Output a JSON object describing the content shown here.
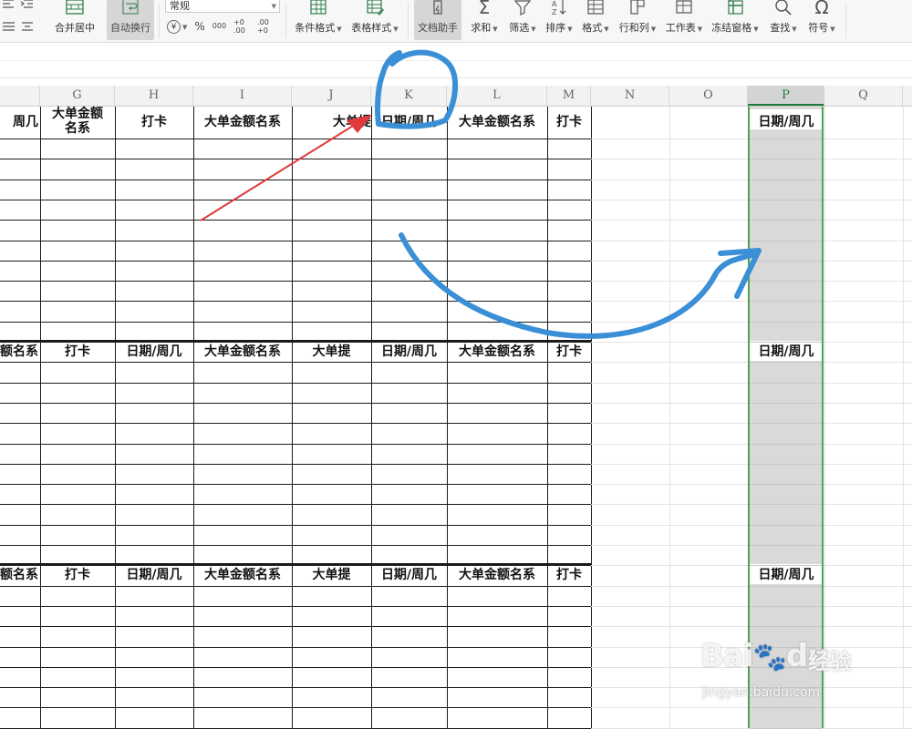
{
  "ribbon": {
    "merge_center": "合并居中",
    "auto_wrap": "自动换行",
    "number_format": "常规",
    "currency": "¥",
    "percent": "%",
    "thousands": "000",
    "dec_increase": "+0 .00",
    "dec_decrease": ".00 +0",
    "conditional_format": "条件格式",
    "table_style": "表格样式",
    "doc_helper": "文档助手",
    "sum": "求和",
    "filter": "筛选",
    "sort": "排序",
    "format": "格式",
    "row_col": "行和列",
    "worksheet": "工作表",
    "freeze": "冻结窗格",
    "find": "查找",
    "symbol": "符号"
  },
  "columns": [
    "G",
    "H",
    "I",
    "J",
    "K",
    "L",
    "M",
    "N",
    "O",
    "P",
    "Q"
  ],
  "selected_column": "P",
  "headers": {
    "block1": [
      "周几",
      "大单金额名系",
      "打卡",
      "大单金额名系",
      "大单提",
      "日期/周几",
      "大单金额名系",
      "打卡"
    ],
    "block2": [
      "额名系",
      "打卡",
      "日期/周几",
      "大单金额名系",
      "大单提",
      "日期/周几",
      "大单金额名系",
      "打卡"
    ],
    "block3": [
      "额名系",
      "打卡",
      "日期/周几",
      "大单金额名系",
      "大单提",
      "日期/周几",
      "大单金额名系",
      "打卡"
    ],
    "p_header": "日期/周几"
  },
  "watermark": {
    "brand": "Bai",
    "brand2": "du",
    "cn": "经验",
    "url": "jingyan.baidu.com"
  },
  "colors": {
    "selection_green": "#4fa24f",
    "annotation_blue": "#3a8fd6",
    "annotation_red": "#e23a3a"
  }
}
